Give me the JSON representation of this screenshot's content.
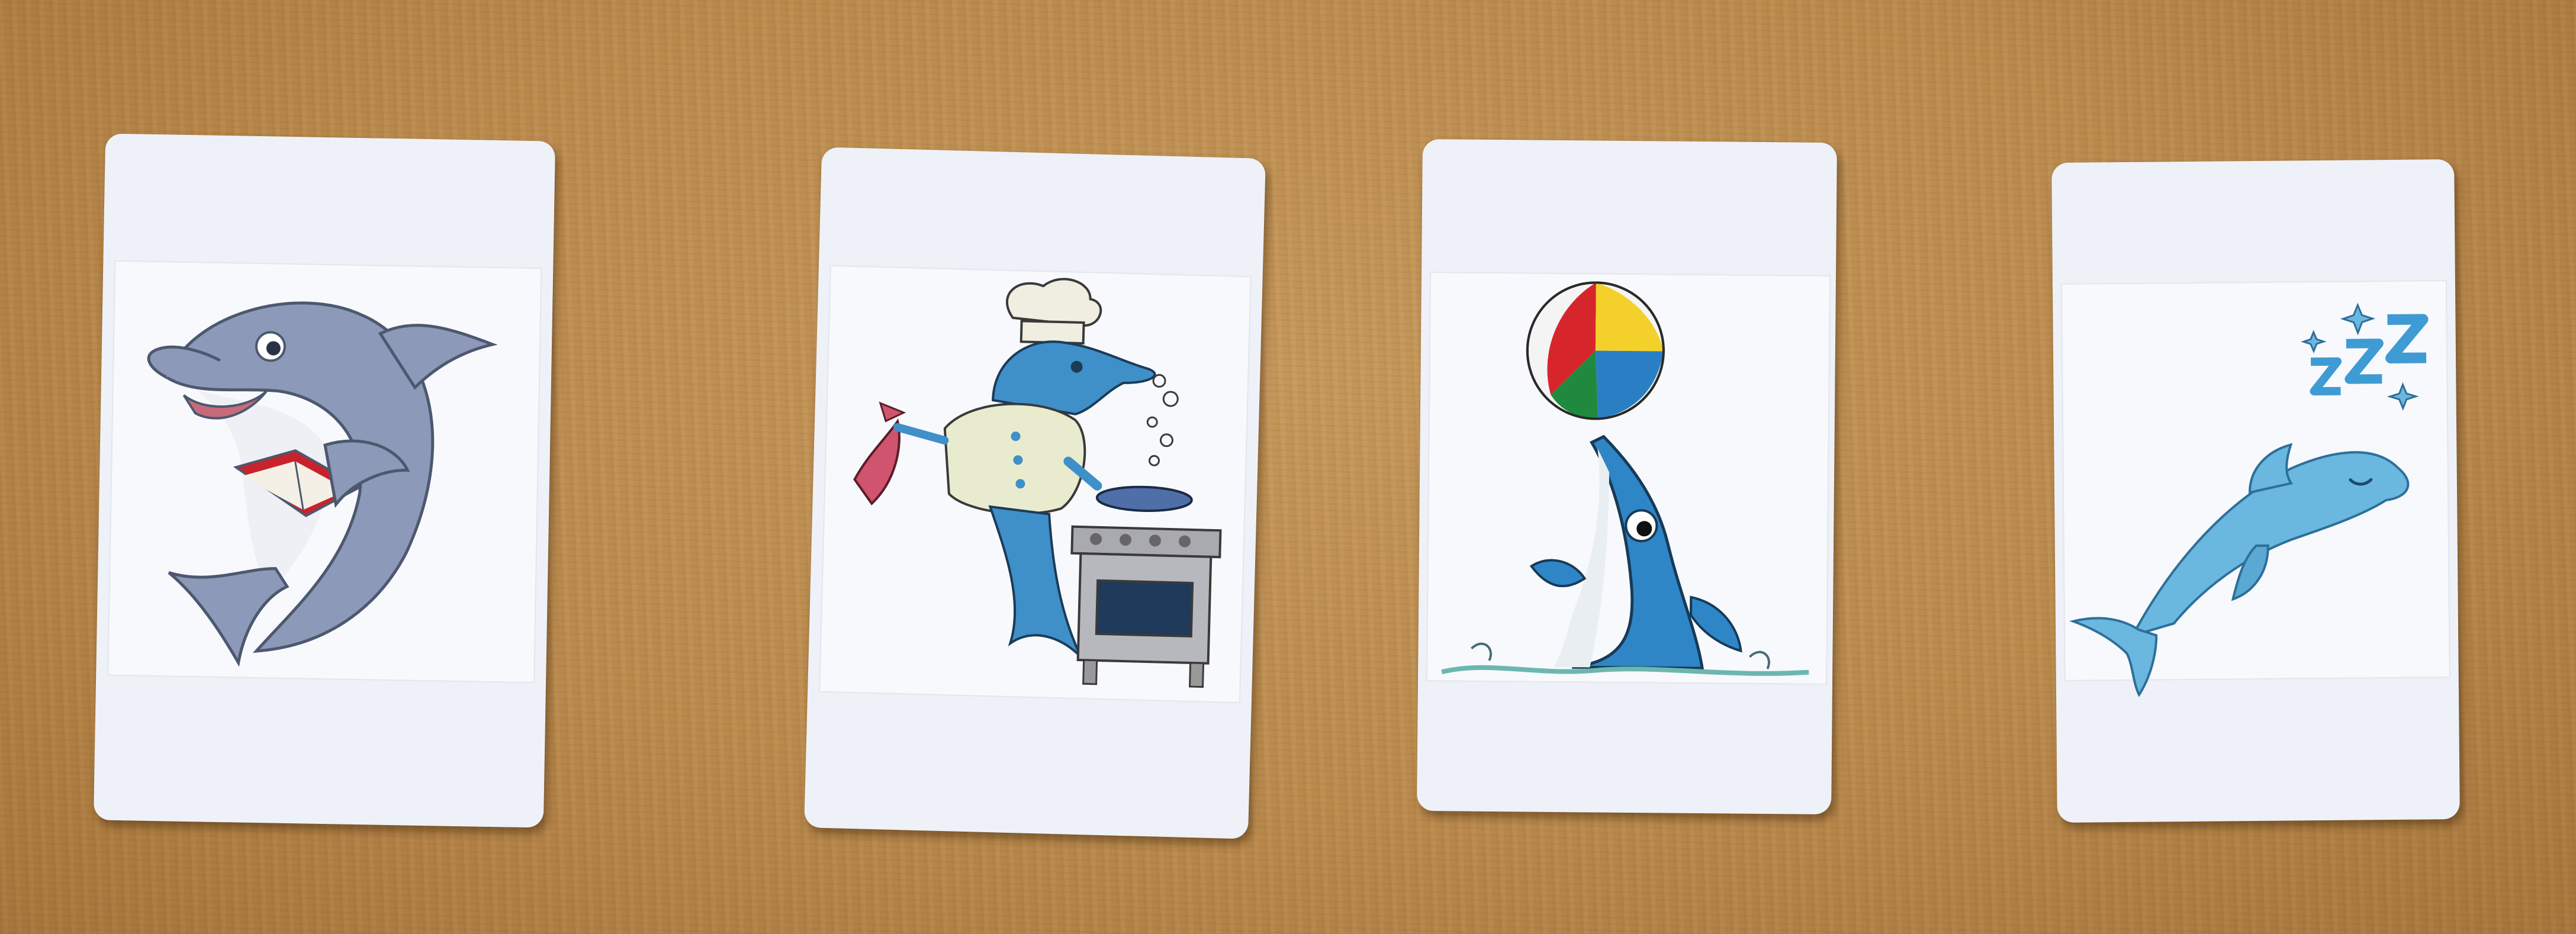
{
  "scene": {
    "description_colors": {
      "table": "#bd8c4e",
      "card": "#eef1f7",
      "dolphin_gray": "#8d99b8",
      "dolphin_blue": "#3f8fc9",
      "dolphin_light_blue": "#6ab7df"
    }
  },
  "cards": [
    {
      "icon": "reading-dolphin-icon"
    },
    {
      "icon": "chef-dolphin-icon"
    },
    {
      "icon": "ball-balancing-dolphin-icon"
    },
    {
      "icon": "sleeping-dolphin-icon"
    }
  ]
}
